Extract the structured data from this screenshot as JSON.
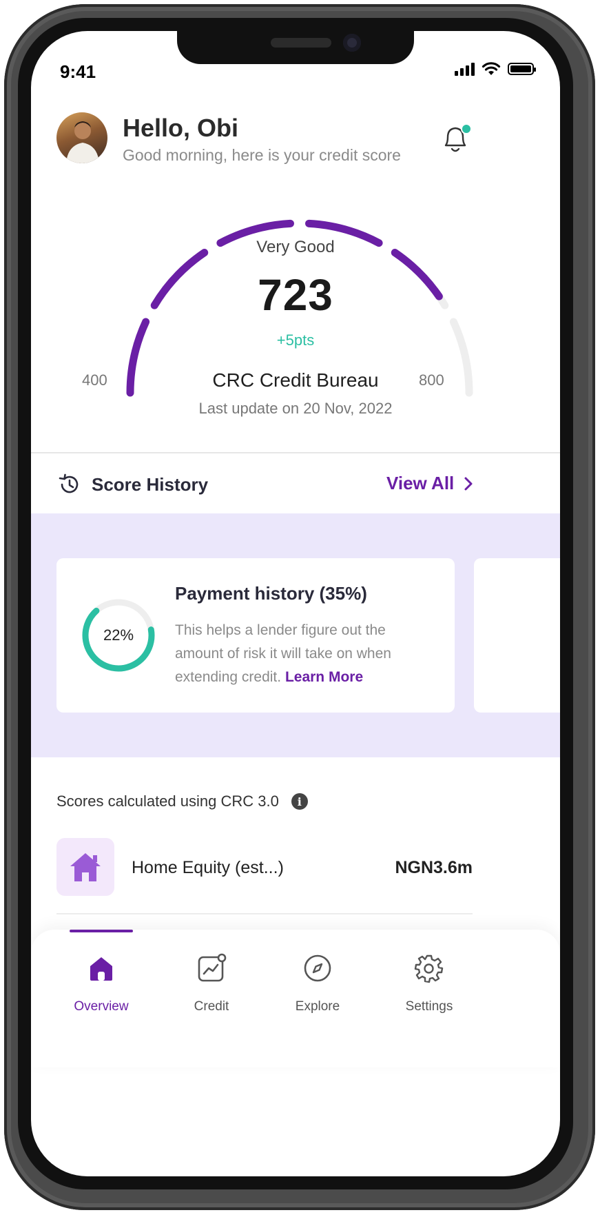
{
  "status_bar": {
    "time": "9:41"
  },
  "header": {
    "greeting": "Hello, Obi",
    "subtitle": "Good morning, here is your credit score"
  },
  "score": {
    "rating": "Very Good",
    "value": "723",
    "change": "+5pts",
    "min_label": "400",
    "max_label": "800",
    "bureau": "CRC Credit Bureau",
    "updated": "Last update on 20 Nov, 2022",
    "score_number": 723,
    "range": [
      400,
      800
    ]
  },
  "score_history": {
    "title": "Score History",
    "view_all": "View All"
  },
  "factor_card": {
    "percent_label": "22%",
    "percent_value": 22,
    "title": "Payment history (35%)",
    "body": "This helps a lender figure out the amount of risk it will take on when extending credit.",
    "link": "Learn More"
  },
  "calc_note": "Scores calculated using CRC 3.0",
  "equity": {
    "label": "Home Equity (est...)",
    "value": "NGN3.6m"
  },
  "tabs": [
    {
      "label": "Overview",
      "icon": "home-icon",
      "active": true
    },
    {
      "label": "Credit",
      "icon": "chart-icon",
      "active": false
    },
    {
      "label": "Explore",
      "icon": "compass-icon",
      "active": false
    },
    {
      "label": "Settings",
      "icon": "gear-icon",
      "active": false
    }
  ],
  "colors": {
    "accent": "#6a1fa5",
    "positive": "#2bbfa3",
    "track": "#eeeeee",
    "band": "#ebe7fb"
  }
}
